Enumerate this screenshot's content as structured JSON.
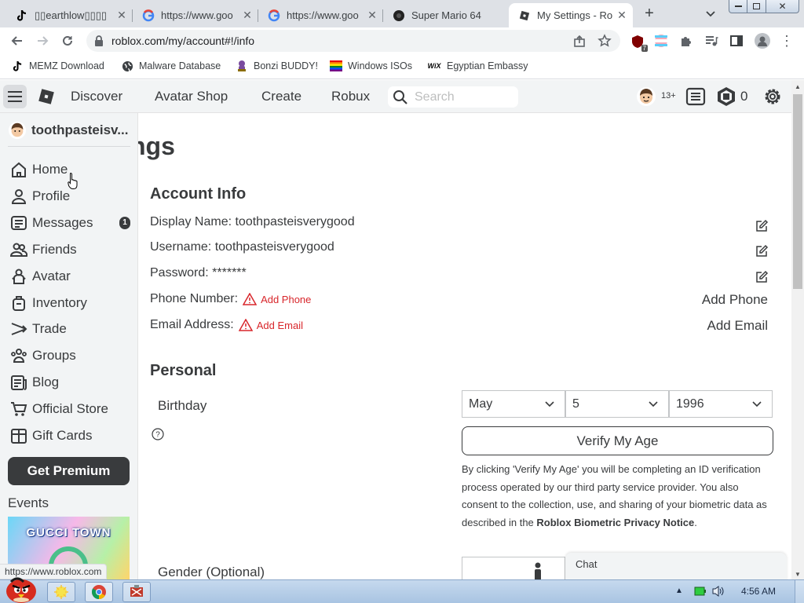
{
  "browser": {
    "tabs": [
      {
        "title": "▯▯earthlow▯▯▯▯",
        "icon": "tiktok-icon"
      },
      {
        "title": "https://www.goo",
        "icon": "google-icon"
      },
      {
        "title": "https://www.goo",
        "icon": "google-icon"
      },
      {
        "title": "Super Mario 64",
        "icon": "mario-icon"
      },
      {
        "title": "My Settings - Ro",
        "icon": "roblox-icon"
      }
    ],
    "new_tab": "+",
    "url": "roblox.com/my/account#!/info",
    "extension_badge": "7",
    "bookmarks": [
      {
        "label": "MEMZ Download",
        "icon": "tiktok-icon"
      },
      {
        "label": "Malware Database",
        "icon": "globe-icon"
      },
      {
        "label": "Bonzi BUDDY!",
        "icon": "bonzi-icon"
      },
      {
        "label": "Windows ISOs",
        "icon": "windows-flag-icon"
      },
      {
        "label": "Egyptian Embassy",
        "icon": "wix-icon"
      }
    ],
    "status_url": "https://www.roblox.com"
  },
  "header": {
    "nav": [
      "Discover",
      "Avatar Shop",
      "Create",
      "Robux"
    ],
    "search_placeholder": "Search",
    "age_badge": "13+",
    "robux_count": "0"
  },
  "sidebar": {
    "username": "toothpasteisv...",
    "items": [
      {
        "label": "Home",
        "icon": "home-icon"
      },
      {
        "label": "Profile",
        "icon": "profile-icon"
      },
      {
        "label": "Messages",
        "icon": "messages-icon",
        "badge": "1"
      },
      {
        "label": "Friends",
        "icon": "friends-icon"
      },
      {
        "label": "Avatar",
        "icon": "avatar-icon"
      },
      {
        "label": "Inventory",
        "icon": "inventory-icon"
      },
      {
        "label": "Trade",
        "icon": "trade-icon"
      },
      {
        "label": "Groups",
        "icon": "groups-icon"
      },
      {
        "label": "Blog",
        "icon": "blog-icon"
      },
      {
        "label": "Official Store",
        "icon": "store-icon"
      },
      {
        "label": "Gift Cards",
        "icon": "gift-cards-icon"
      }
    ],
    "premium_button": "Get Premium",
    "events_label": "Events",
    "event_banner_text": "GUCCI TOWN"
  },
  "main": {
    "page_title_fragment": "ngs",
    "account_info": {
      "heading": "Account Info",
      "display_name_label": "Display Name:",
      "display_name": "toothpasteisverygood",
      "username_label": "Username:",
      "username": "toothpasteisverygood",
      "password_label": "Password:",
      "password": "*******",
      "phone_label": "Phone Number:",
      "phone_warning": "Add Phone",
      "phone_action": "Add Phone",
      "email_label": "Email Address:",
      "email_warning": "Add Email",
      "email_action": "Add Email"
    },
    "personal": {
      "heading": "Personal",
      "birthday_label": "Birthday",
      "birth_month": "May",
      "birth_day": "5",
      "birth_year": "1996",
      "verify_button": "Verify My Age",
      "verify_text": "By clicking 'Verify My Age' you will be completing an ID verification process operated by our third party service provider. You also consent to the collection, use, and sharing of your biometric data as described in the",
      "verify_link": "Roblox Biometric Privacy Notice",
      "verify_end": ".",
      "gender_label": "Gender (Optional)"
    },
    "chat_label": "Chat"
  },
  "taskbar": {
    "time": "4:56 AM"
  },
  "colors": {
    "tabstrip_bg": "#dee1e6",
    "roblox_header_bg": "#f2f4f5",
    "warning_red": "#d8262b",
    "premium_button_bg": "#393b3d"
  }
}
